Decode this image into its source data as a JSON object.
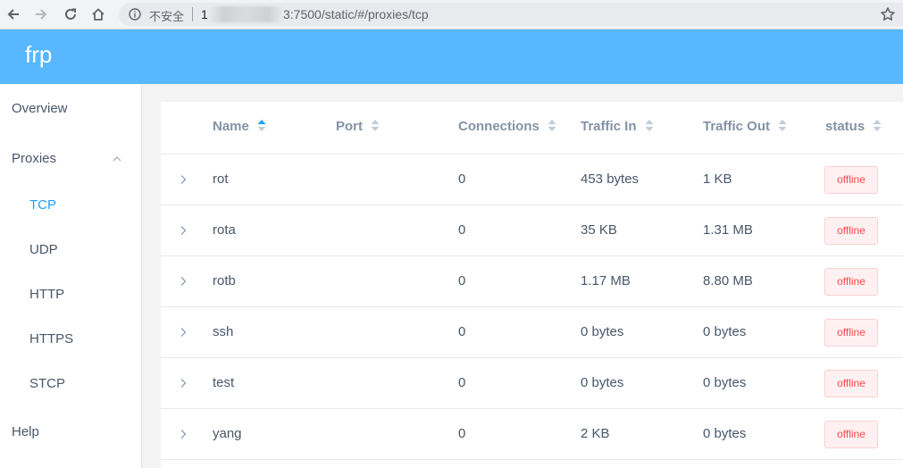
{
  "browser": {
    "security_label": "不安全",
    "url_host_visible": "1",
    "url_tail": "3:7500/static/#/proxies/tcp"
  },
  "app": {
    "brand": "frp"
  },
  "sidebar": {
    "overview": "Overview",
    "proxies": "Proxies",
    "subitems": [
      "TCP",
      "UDP",
      "HTTP",
      "HTTPS",
      "STCP"
    ],
    "active": "TCP",
    "help": "Help"
  },
  "table": {
    "columns": [
      "Name",
      "Port",
      "Connections",
      "Traffic In",
      "Traffic Out",
      "status"
    ],
    "sorted_by": "Name",
    "sort_direction": "ascending",
    "rows": [
      {
        "name": "rot",
        "port": "",
        "connections": "0",
        "traffic_in": "453 bytes",
        "traffic_out": "1 KB",
        "status": "offline"
      },
      {
        "name": "rota",
        "port": "",
        "connections": "0",
        "traffic_in": "35 KB",
        "traffic_out": "1.31 MB",
        "status": "offline"
      },
      {
        "name": "rotb",
        "port": "",
        "connections": "0",
        "traffic_in": "1.17 MB",
        "traffic_out": "8.80 MB",
        "status": "offline"
      },
      {
        "name": "ssh",
        "port": "",
        "connections": "0",
        "traffic_in": "0 bytes",
        "traffic_out": "0 bytes",
        "status": "offline"
      },
      {
        "name": "test",
        "port": "",
        "connections": "0",
        "traffic_in": "0 bytes",
        "traffic_out": "0 bytes",
        "status": "offline"
      },
      {
        "name": "yang",
        "port": "",
        "connections": "0",
        "traffic_in": "2 KB",
        "traffic_out": "0 bytes",
        "status": "offline"
      }
    ]
  },
  "colors": {
    "header": "#58b7ff",
    "active": "#20a0ff",
    "offline_text": "#ff4949",
    "offline_bg": "#fff1f1",
    "offline_border": "#fbcfcf"
  }
}
